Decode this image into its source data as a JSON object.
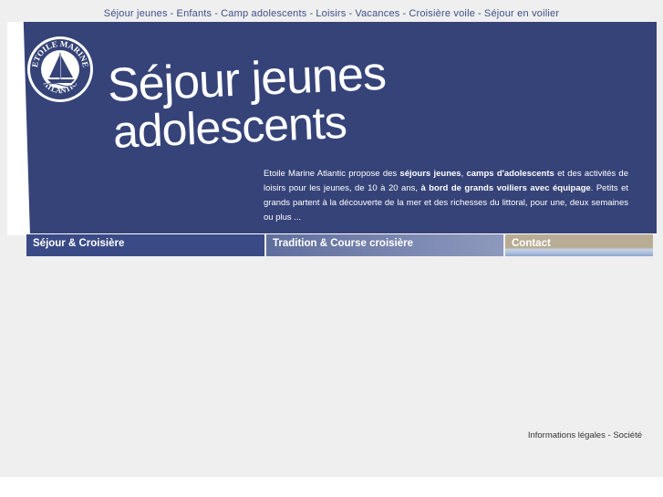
{
  "top_nav": {
    "items": [
      "Séjour jeunes",
      "Enfants",
      "Camp adolescents",
      "Loisirs",
      "Vacances",
      "Croisière voile",
      "Séjour en voilier"
    ],
    "separator": "-"
  },
  "logo": {
    "text_top": "ETOILE MARINE",
    "text_bottom": "ATLANTIC",
    "icon": "sailboat-icon"
  },
  "banner": {
    "title_line1_a": "Séjour",
    "title_line1_b": " jeunes",
    "title_line2": "adolescents",
    "intro": {
      "p1": "Etoile Marine Atlantic propose des ",
      "b1": "séjours jeunes",
      "p2": ", ",
      "b2": "camps d'adolescents",
      "p3": " et des activités de loisirs pour les jeunes, de 10 à 20 ans, ",
      "b3": "à bord de grands voiliers avec équipage",
      "p4": ". Petits et grands partent à la découverte de la mer et des richesses du littoral, pour une, deux semaines ou plus ..."
    }
  },
  "tabs": [
    "Séjour & Croisière",
    "Tradition & Course croisière",
    "Contact"
  ],
  "footer": {
    "legal": "Informations légales",
    "sep": "-",
    "company": "Société"
  },
  "colors": {
    "banner_bg": "#354378",
    "nav_text": "#3f4f8a",
    "page_bg": "#efefef"
  }
}
